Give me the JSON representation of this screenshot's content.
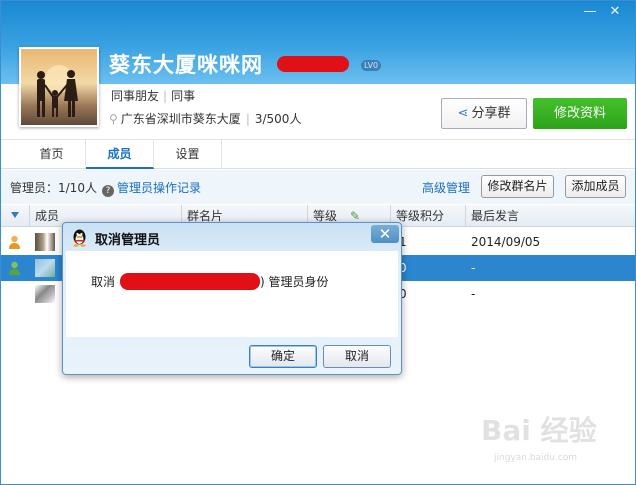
{
  "window": {
    "controls": {
      "minimize": "—",
      "close": "✕"
    }
  },
  "header": {
    "group_name": "葵东大厦咪咪网",
    "level_badge": "LV0",
    "tags": [
      "同事朋友",
      "同事"
    ],
    "location": "广东省深圳市葵东大厦",
    "member_count": "3/500人",
    "share_button": "分享群",
    "edit_button": "修改资料"
  },
  "tabs": [
    {
      "label": "首页",
      "active": false
    },
    {
      "label": "成员",
      "active": true
    },
    {
      "label": "设置",
      "active": false
    }
  ],
  "toolbar": {
    "admin_count": "管理员：1/10人",
    "admin_log": "管理员操作记录",
    "advanced": "高级管理",
    "edit_card": "修改群名片",
    "add_member": "添加成员"
  },
  "table": {
    "columns": [
      "成员",
      "群名片",
      "等级",
      "等级积分",
      "最后发言"
    ],
    "rows": [
      {
        "last_speak": "2014/09/05",
        "points": "1",
        "selected": false
      },
      {
        "last_speak": "-",
        "points": "0",
        "selected": true
      },
      {
        "last_speak": "-",
        "points": "0",
        "selected": false
      }
    ]
  },
  "dialog": {
    "title": "取消管理员",
    "message_prefix": "取消",
    "message_suffix": ") 管理员身份",
    "ok": "确定",
    "cancel": "取消",
    "close": "✕"
  },
  "watermark": {
    "main": "Bai 经验",
    "sub": "jingyan.baidu.com"
  },
  "colors": {
    "header_blue": "#1a88d3",
    "edit_green": "#2ea31a",
    "selected_row": "#2c86cf",
    "redaction": "#e10f16"
  }
}
